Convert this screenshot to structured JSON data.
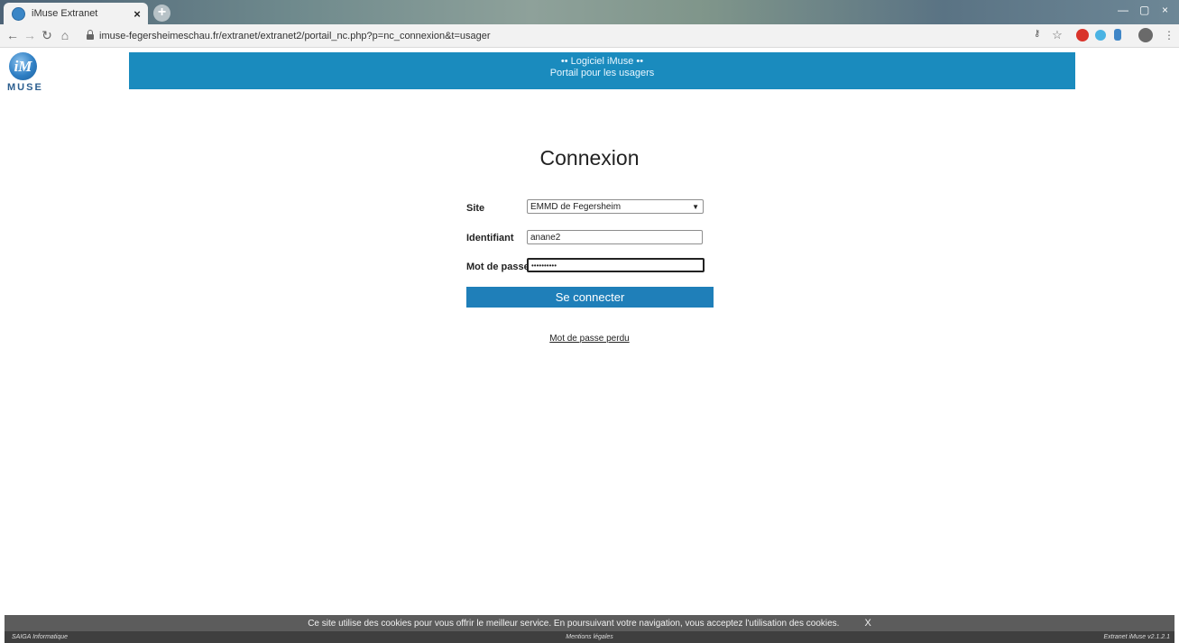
{
  "browser": {
    "tab_title": "iMuse Extranet",
    "tab_close": "×",
    "new_tab": "+",
    "url": "imuse-fegersheimeschau.fr/extranet/extranet2/portail_nc.php?p=nc_connexion&t=usager",
    "window_minimize": "—",
    "window_restore": "▢",
    "window_close": "×"
  },
  "logo": {
    "text": "MUSE",
    "mark": "iM"
  },
  "banner": {
    "line1": "•• Logiciel iMuse ••",
    "line2": "Portail pour les usagers"
  },
  "login": {
    "title": "Connexion",
    "site_label": "Site",
    "site_value": "EMMD de Fegersheim",
    "id_label": "Identifiant",
    "id_value": "anane2",
    "password_label": "Mot de passe",
    "password_value": "••••••••••",
    "submit_label": "Se connecter",
    "lost_password": "Mot de passe perdu"
  },
  "cookie_banner": {
    "text": "Ce site utilise des cookies pour vous offrir le meilleur service. En poursuivant votre navigation, vous acceptez l'utilisation des cookies.",
    "close": "X"
  },
  "footer": {
    "left": "SAIGA Informatique",
    "center": "Mentions légales",
    "right": "Extranet iMuse v2.1.2.1"
  },
  "colors": {
    "banner": "#1a8bbe",
    "button": "#1f7fb9"
  }
}
